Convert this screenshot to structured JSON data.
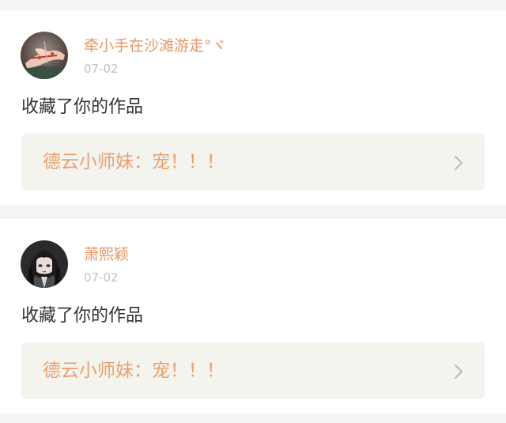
{
  "notifications": [
    {
      "username": "牵小手在沙滩游走°ヾ",
      "date": "07-02",
      "action": "收藏了你的作品",
      "work_title": "德云小师妹：宠！！！",
      "avatar_icon": "avatar-hand-photo-icon"
    },
    {
      "username": "萧熙颖",
      "date": "07-02",
      "action": "收藏了你的作品",
      "work_title": "德云小师妹：宠！！！",
      "avatar_icon": "avatar-anime-girl-icon"
    }
  ],
  "colors": {
    "username": "#e59863",
    "work_title": "#e9a070",
    "date": "#c2c2c2",
    "body_text": "#333333",
    "link_background": "#f4f4ef",
    "page_background": "#f6f5f4"
  }
}
